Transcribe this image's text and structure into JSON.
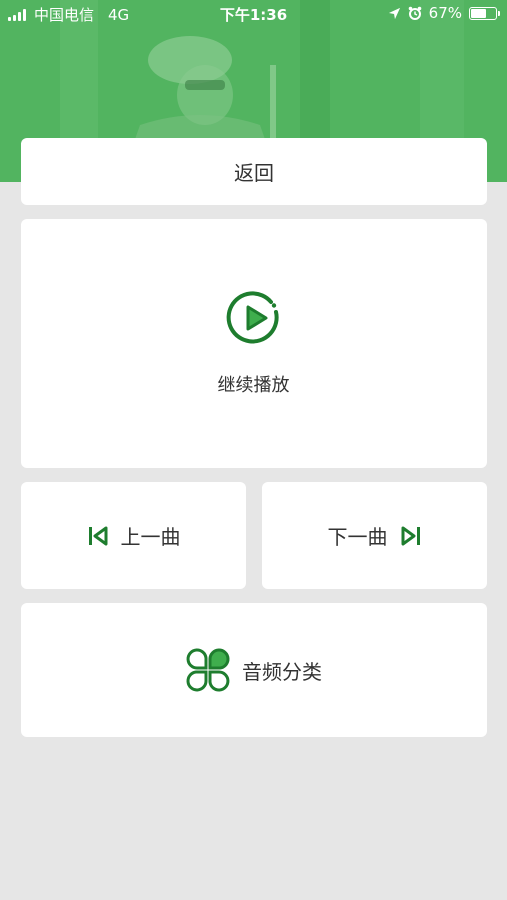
{
  "status_bar": {
    "carrier": "中国电信",
    "network": "4G",
    "time": "下午1:36",
    "battery": "67%",
    "battery_level": 0.67,
    "location_icon": "location-arrow-icon",
    "alarm_icon": "alarm-clock-icon"
  },
  "nav": {
    "back_label": "返回"
  },
  "player": {
    "continue_label": "继续播放",
    "play_icon": "play-circle-icon",
    "prev_label": "上一曲",
    "prev_icon": "skip-previous-icon",
    "next_label": "下一曲",
    "next_icon": "skip-next-icon",
    "category_label": "音频分类",
    "category_icon": "clover-category-icon"
  },
  "colors": {
    "accent_green": "#1e7d2e",
    "header_green": "#4aae58",
    "background": "#e6e6e6",
    "card": "#ffffff"
  }
}
